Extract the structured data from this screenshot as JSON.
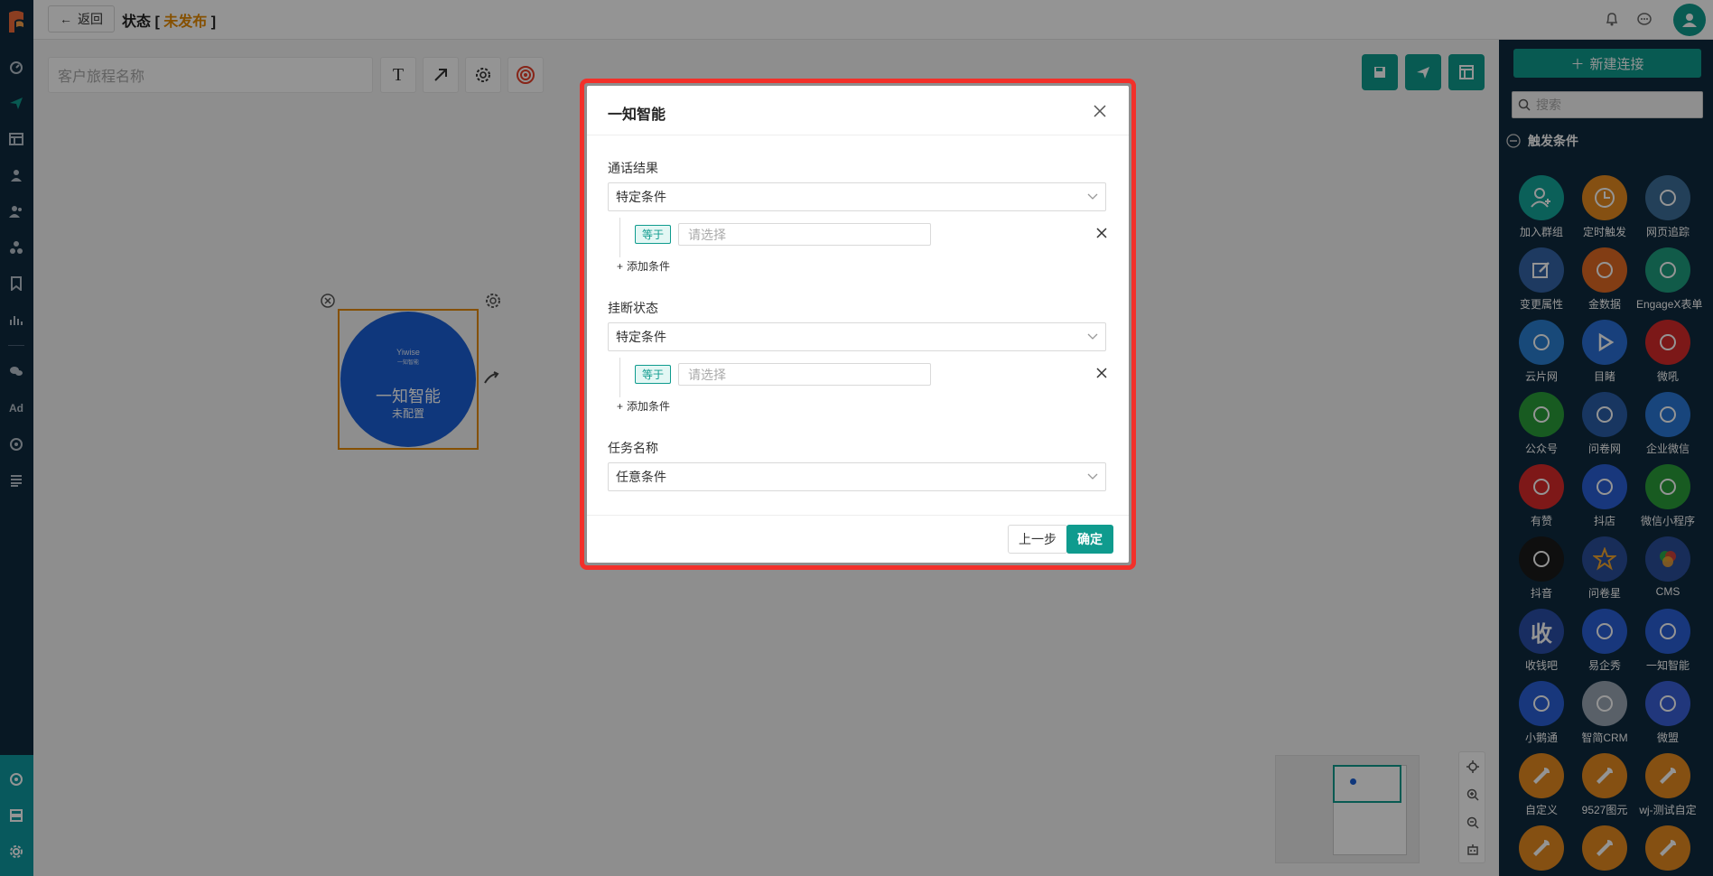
{
  "topbar": {
    "back_label": "返回",
    "status_prefix": "状态 [",
    "status_value": "未发布",
    "status_suffix": "]"
  },
  "toolbar": {
    "journey_name_placeholder": "客户旅程名称"
  },
  "node": {
    "brand": "Yiwise",
    "brand_sub": "一知智能",
    "name": "一知智能",
    "status": "未配置"
  },
  "right_panel": {
    "new_connection_label": "新建连接",
    "search_placeholder": "搜索",
    "section_title": "触发条件",
    "items": [
      {
        "label": "加入群组",
        "icon": "user-add-icon",
        "color": "#13a69a"
      },
      {
        "label": "定时触发",
        "icon": "clock-icon",
        "color": "#e58a1f"
      },
      {
        "label": "网页追踪",
        "icon": "web-track-icon",
        "color": "#3d6e9a"
      },
      {
        "label": "变更属性",
        "icon": "edit-icon",
        "color": "#3564a8"
      },
      {
        "label": "金数据",
        "icon": "jinshuju-icon",
        "color": "#e06a24"
      },
      {
        "label": "EngageX表单",
        "icon": "engagex-icon",
        "color": "#1e9e7e"
      },
      {
        "label": "云片网",
        "icon": "yunpian-icon",
        "color": "#2a7fd1"
      },
      {
        "label": "目睹",
        "icon": "play-icon",
        "color": "#2a6fd6"
      },
      {
        "label": "微吼",
        "icon": "vhall-icon",
        "color": "#d62a2a"
      },
      {
        "label": "公众号",
        "icon": "wechat-icon",
        "color": "#2a9e3a"
      },
      {
        "label": "问卷网",
        "icon": "wenjuan-icon",
        "color": "#2a5ea8"
      },
      {
        "label": "企业微信",
        "icon": "wecom-icon",
        "color": "#2a78d6"
      },
      {
        "label": "有赞",
        "icon": "youzan-icon",
        "color": "#d92a2a"
      },
      {
        "label": "抖店",
        "icon": "doudian-icon",
        "color": "#2a5fd6"
      },
      {
        "label": "微信小程序",
        "icon": "miniprogram-icon",
        "color": "#2a9e3a"
      },
      {
        "label": "抖音",
        "icon": "tiktok-icon",
        "color": "#1a1a1a"
      },
      {
        "label": "问卷星",
        "icon": "star-icon",
        "color": "#2a4e9a"
      },
      {
        "label": "CMS",
        "icon": "cms-icon",
        "color": "#2a4e9a"
      },
      {
        "label": "收钱吧",
        "icon": "shouqianba-icon",
        "color": "#2a4ea8"
      },
      {
        "label": "易企秀",
        "icon": "eqxiu-icon",
        "color": "#2a5fd6"
      },
      {
        "label": "一知智能",
        "icon": "yiwise-icon",
        "color": "#2a5fd6"
      },
      {
        "label": "小鹅通",
        "icon": "xiaoetong-icon",
        "color": "#2a5fd6"
      },
      {
        "label": "智简CRM",
        "icon": "crm-icon",
        "color": "#9aa6b4"
      },
      {
        "label": "微盟",
        "icon": "weimob-icon",
        "color": "#3a5fd6"
      },
      {
        "label": "自定义",
        "icon": "wrench-icon",
        "color": "#e58a1f"
      },
      {
        "label": "9527图元",
        "icon": "wrench-icon",
        "color": "#e58a1f"
      },
      {
        "label": "wj-测试自定",
        "icon": "wrench-icon",
        "color": "#e58a1f"
      },
      {
        "label": "",
        "icon": "wrench-icon",
        "color": "#e58a1f"
      },
      {
        "label": "",
        "icon": "wrench-icon",
        "color": "#e58a1f"
      },
      {
        "label": "",
        "icon": "wrench-icon",
        "color": "#e58a1f"
      }
    ]
  },
  "modal": {
    "title": "一知智能",
    "field1": {
      "label": "通话结果",
      "value": "特定条件",
      "op": "等于",
      "placeholder": "请选择",
      "add_label": "添加条件"
    },
    "field2": {
      "label": "挂断状态",
      "value": "特定条件",
      "op": "等于",
      "placeholder": "请选择",
      "add_label": "添加条件"
    },
    "field3": {
      "label": "任务名称",
      "value": "任意条件"
    },
    "prev_label": "上一步",
    "ok_label": "确定"
  },
  "colors": {
    "accent": "#0f9b8e",
    "nav_bg": "#0e2a3f",
    "highlight": "#f2302a",
    "unpublished": "#e68a00"
  }
}
